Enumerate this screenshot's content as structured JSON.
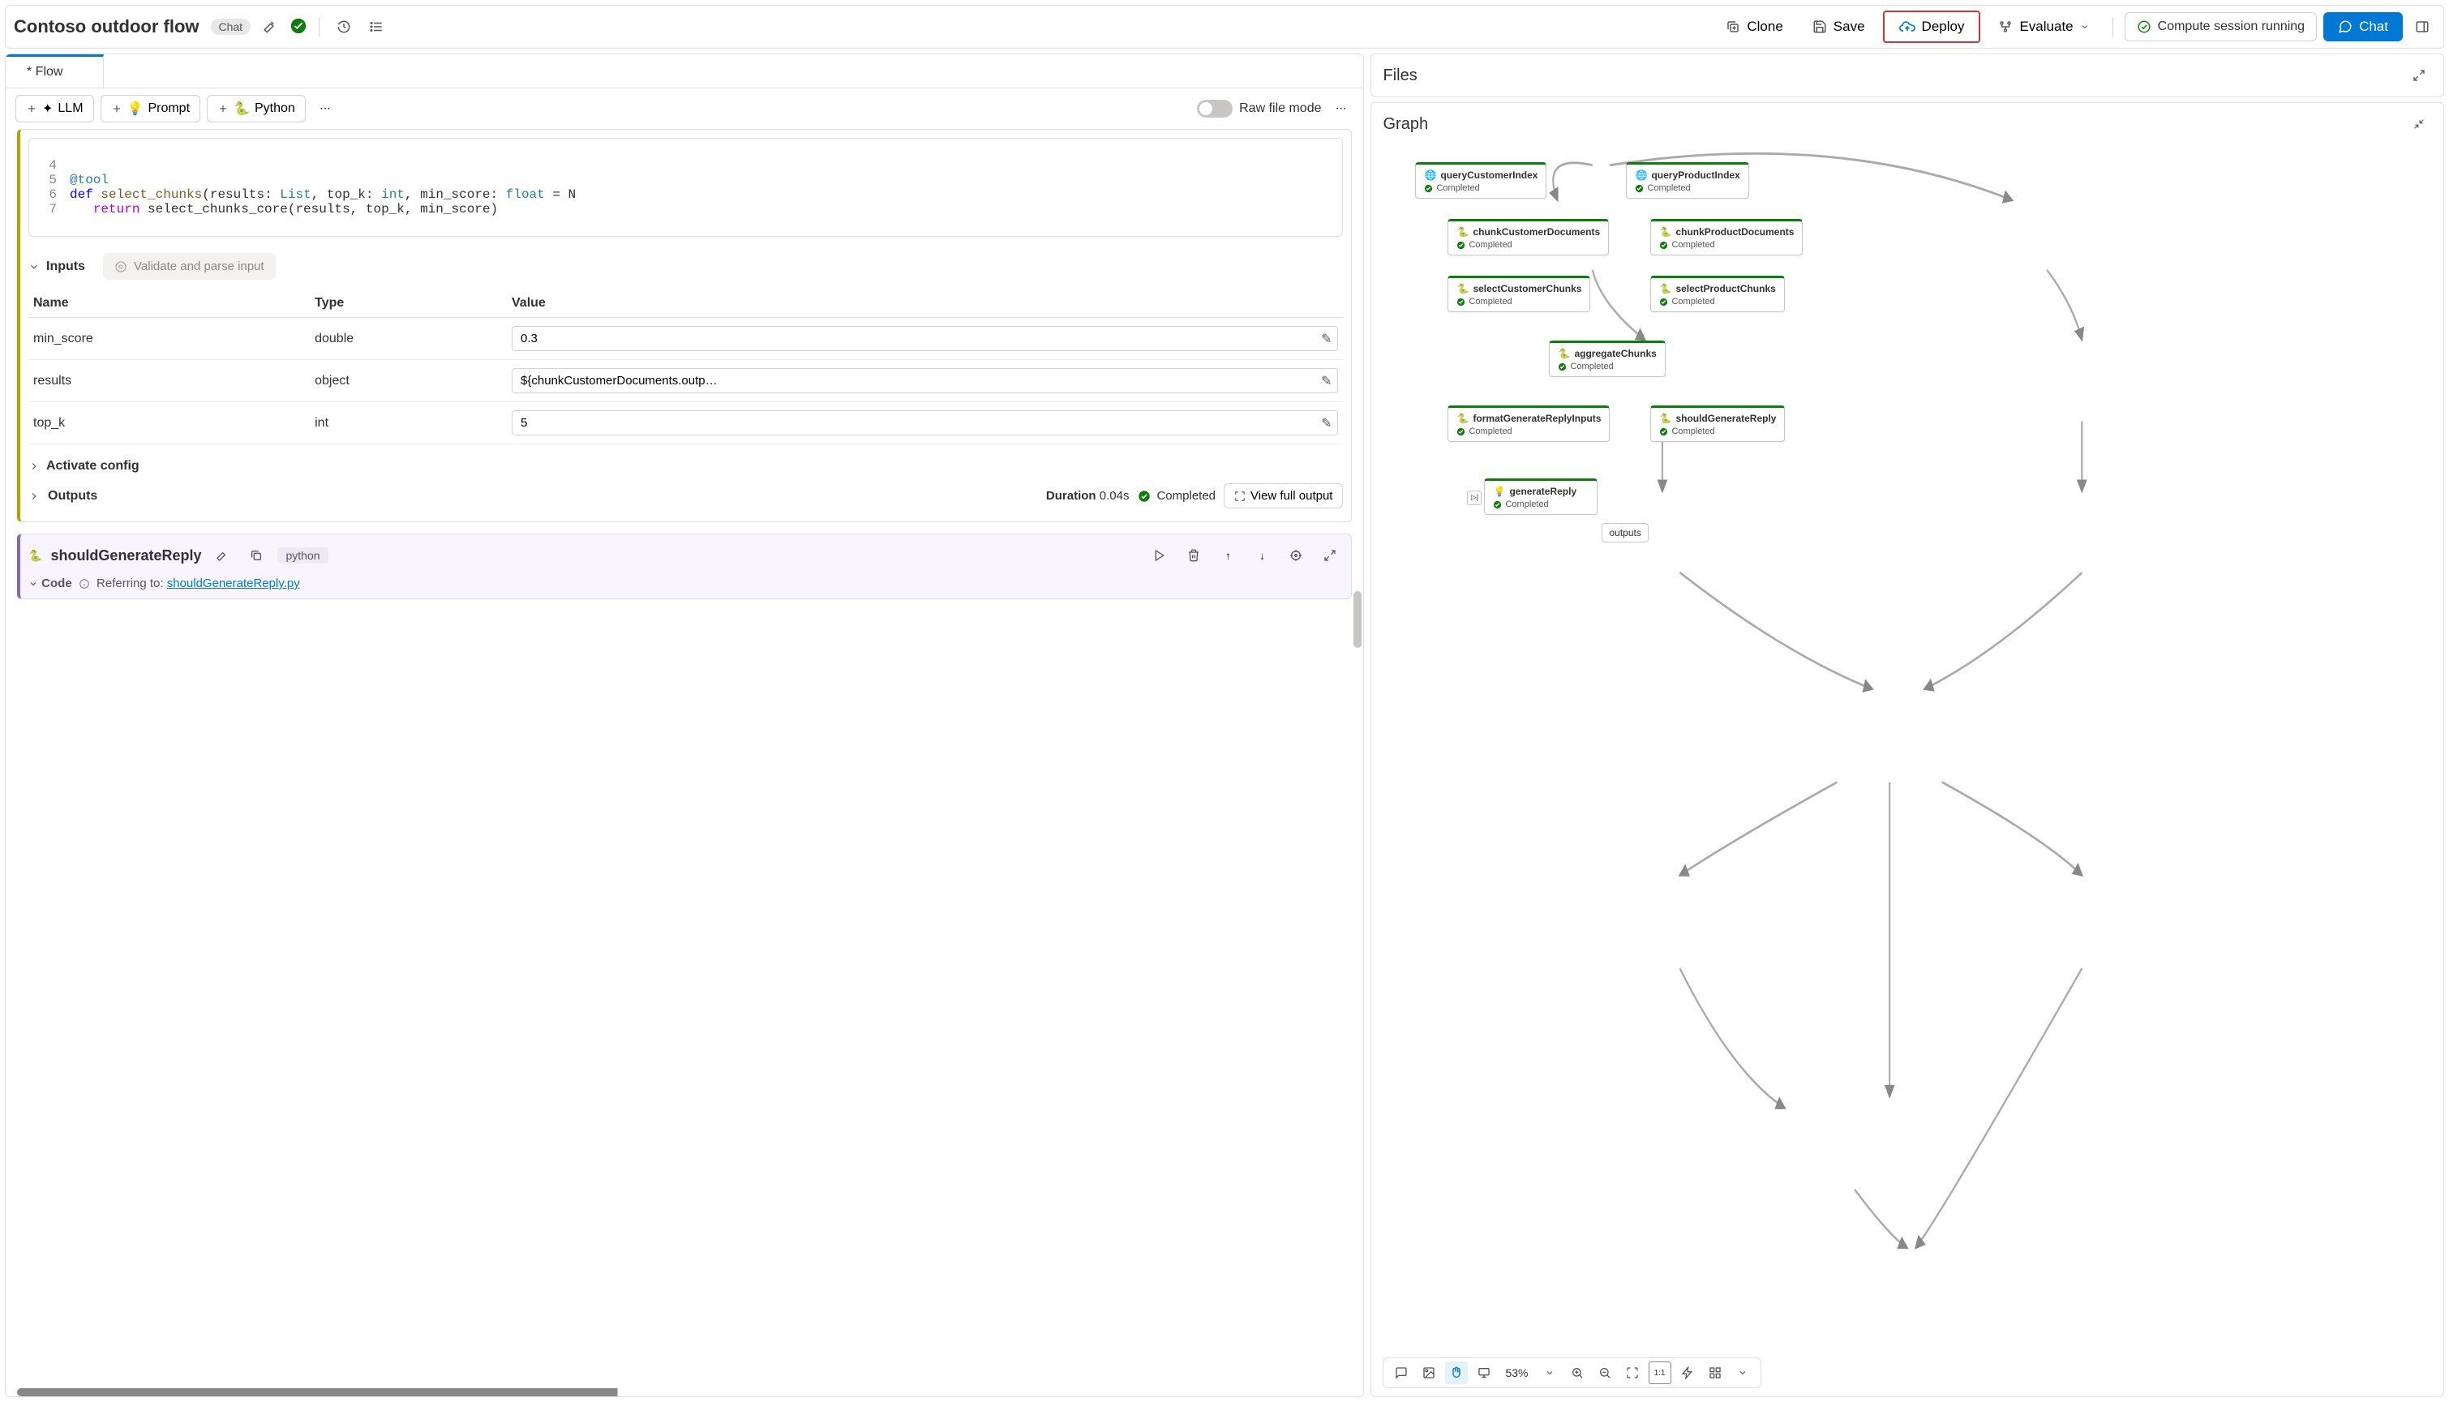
{
  "header": {
    "title": "Contoso outdoor flow",
    "chat_badge": "Chat",
    "clone": "Clone",
    "save": "Save",
    "deploy": "Deploy",
    "evaluate": "Evaluate",
    "compute_status": "Compute session running",
    "chat_button": "Chat"
  },
  "tabs": {
    "flow": "* Flow"
  },
  "node_tools": {
    "llm": "LLM",
    "prompt": "Prompt",
    "python": "Python",
    "raw_mode": "Raw file mode"
  },
  "code": {
    "lines": [
      "4",
      "5",
      "6",
      "7"
    ],
    "l5_decorator": "@tool",
    "l6_def": "def",
    "l6_name": "select_chunks",
    "l6_sig_a": "(results: ",
    "l6_sig_list": "List",
    "l6_sig_b": ", top_k: ",
    "l6_sig_int": "int",
    "l6_sig_c": ", min_score: ",
    "l6_sig_float": "float",
    "l6_sig_d": " = N",
    "l7_return": "return",
    "l7_body": " select_chunks_core(results, top_k, min_score)"
  },
  "inputs": {
    "label": "Inputs",
    "validate": "Validate and parse input",
    "cols": {
      "name": "Name",
      "type": "Type",
      "value": "Value"
    },
    "rows": [
      {
        "name": "min_score",
        "type": "double",
        "value": "0.3"
      },
      {
        "name": "results",
        "type": "object",
        "value": "${chunkCustomerDocuments.outp…"
      },
      {
        "name": "top_k",
        "type": "int",
        "value": "5"
      }
    ]
  },
  "sections": {
    "activate_config": "Activate config",
    "outputs": "Outputs",
    "duration_label": "Duration",
    "duration_value": "0.04s",
    "completed": "Completed",
    "view_full": "View full output"
  },
  "reply_node": {
    "title": "shouldGenerateReply",
    "lang": "python",
    "code_label": "Code",
    "referring": "Referring to: ",
    "ref_link": "shouldGenerateReply.py"
  },
  "right": {
    "files": "Files",
    "graph": "Graph",
    "zoom": "53%",
    "completed": "Completed",
    "outputs_label": "outputs",
    "nodes": {
      "queryCustomerIndex": "queryCustomerIndex",
      "queryProductIndex": "queryProductIndex",
      "chunkCustomerDocuments": "chunkCustomerDocuments",
      "chunkProductDocuments": "chunkProductDocuments",
      "selectCustomerChunks": "selectCustomerChunks",
      "selectProductChunks": "selectProductChunks",
      "aggregateChunks": "aggregateChunks",
      "formatGenerateReplyInputs": "formatGenerateReplyInputs",
      "shouldGenerateReply": "shouldGenerateReply",
      "generateReply": "generateReply"
    }
  }
}
